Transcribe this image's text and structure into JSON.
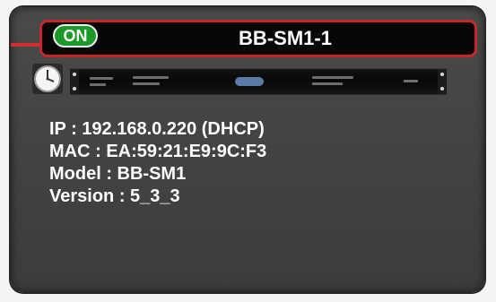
{
  "device": {
    "status_label": "ON",
    "name": "BB-SM1-1",
    "info": {
      "ip": "IP : 192.168.0.220 (DHCP)",
      "mac": "MAC : EA:59:21:E9:9C:F3",
      "model": "Model : BB-SM1",
      "version": "Version : 5_3_3"
    }
  },
  "colors": {
    "status_on": "#1a9a28",
    "header_border": "#c62828",
    "link_line": "#d32f2f",
    "card_background": "#444444"
  },
  "icons": {
    "clock": "clock-icon",
    "device_image": "rack-unit-image"
  }
}
